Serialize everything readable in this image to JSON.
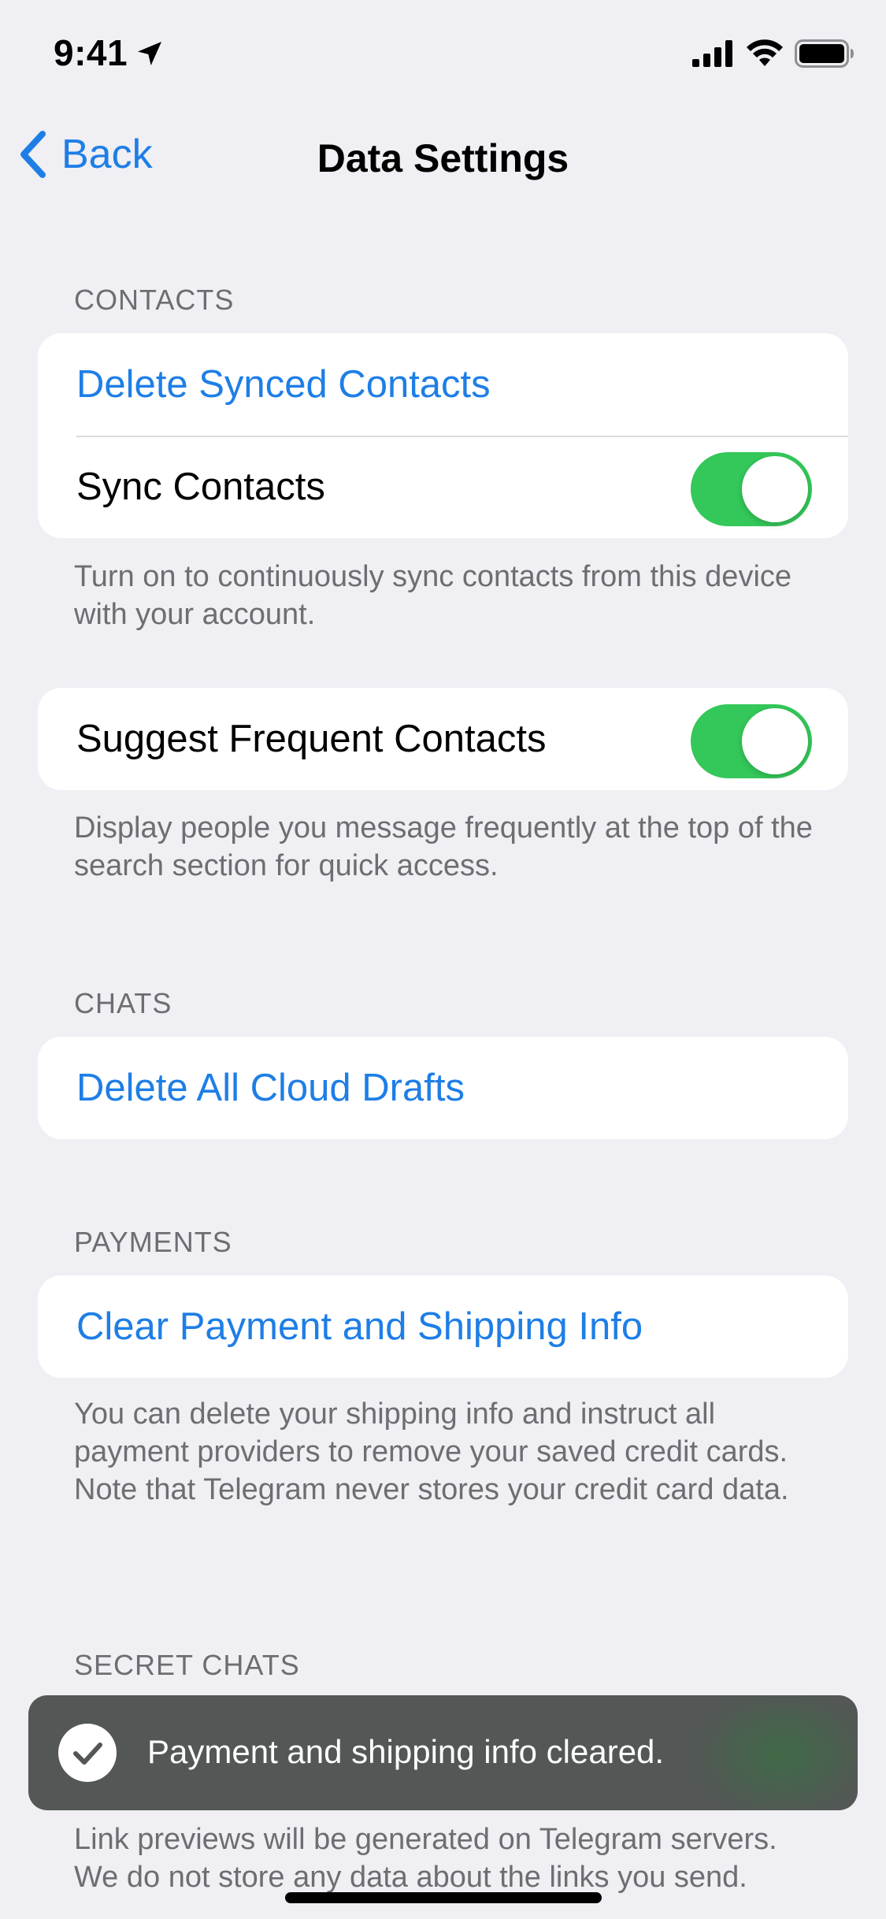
{
  "status_bar": {
    "time": "9:41"
  },
  "nav": {
    "back_label": "Back",
    "title": "Data Settings"
  },
  "contacts": {
    "header": "CONTACTS",
    "delete_synced": "Delete Synced Contacts",
    "sync_label": "Sync Contacts",
    "sync_on": true,
    "sync_footer": "Turn on to continuously sync contacts from this device with your account.",
    "suggest_label": "Suggest Frequent Contacts",
    "suggest_on": true,
    "suggest_footer": "Display people you message frequently at the top of the search section for quick access."
  },
  "chats": {
    "header": "CHATS",
    "delete_drafts": "Delete All Cloud Drafts"
  },
  "payments": {
    "header": "PAYMENTS",
    "clear_label": "Clear Payment and Shipping Info",
    "footer": "You can delete your shipping info and instruct all payment providers to remove your saved credit cards. Note that Telegram never stores your credit card data."
  },
  "secret_chats": {
    "header": "SECRET CHATS",
    "footer": "Link previews will be generated on Telegram servers. We do not store any data about the links you send."
  },
  "toast": {
    "message": "Payment and shipping info cleared."
  },
  "colors": {
    "accent": "#1e7ee6",
    "toggle_on": "#34c759",
    "background": "#efeff4",
    "toast_bg": "#535755"
  }
}
